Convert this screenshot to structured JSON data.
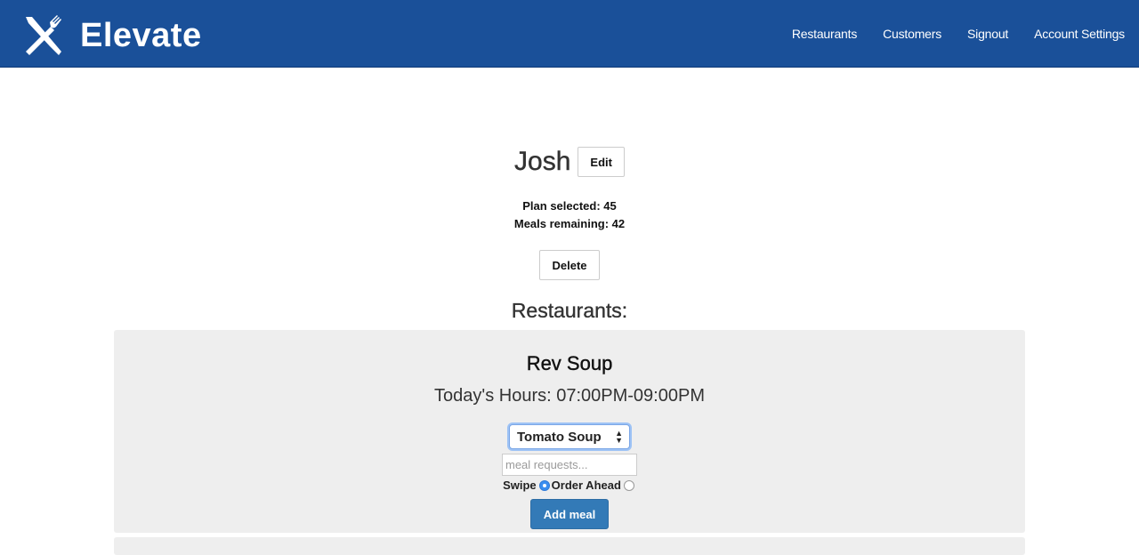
{
  "nav": {
    "brand": "Elevate",
    "logo_icon": "fork-knife-icon",
    "links": [
      "Restaurants",
      "Customers",
      "Signout",
      "Account Settings"
    ]
  },
  "customer": {
    "name": "Josh",
    "edit_label": "Edit",
    "plan_text": "Plan selected: 45",
    "meals_text": "Meals remaining: 42",
    "delete_label": "Delete"
  },
  "restaurants_heading": "Restaurants:",
  "restaurant": {
    "name": "Rev Soup",
    "hours": "Today's Hours: 07:00PM-09:00PM",
    "meal_selected": "Tomato Soup",
    "request_placeholder": "meal requests...",
    "swipe_label": "Swipe",
    "order_ahead_label": "Order Ahead",
    "selected_option": "Swipe",
    "add_label": "Add meal"
  },
  "colors": {
    "navbar": "#1a5099",
    "primary_button": "#337ab7",
    "card_background": "#eeeeee"
  }
}
